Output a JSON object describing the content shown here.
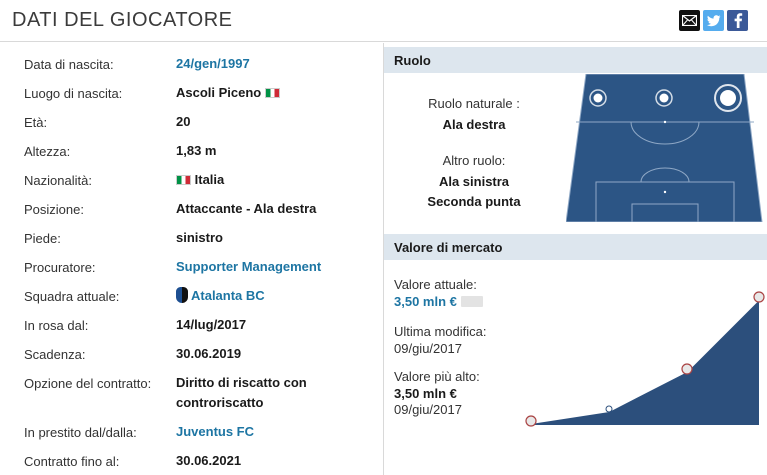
{
  "header": {
    "title": "DATI DEL GIOCATORE"
  },
  "share": {
    "email_icon": "email-icon",
    "twitter_icon": "twitter-icon",
    "facebook_icon": "facebook-icon",
    "twitter_glyph": "t",
    "facebook_glyph": "f"
  },
  "player": {
    "rows": [
      {
        "label": "Data di nascita:",
        "value": "24/gen/1997"
      },
      {
        "label": "Luogo di nascita:",
        "value": "Ascoli Piceno"
      },
      {
        "label": "Età:",
        "value": "20"
      },
      {
        "label": "Altezza:",
        "value": "1,83 m"
      },
      {
        "label": "Nazionalità:",
        "value": "Italia"
      },
      {
        "label": "Posizione:",
        "value": "Attaccante - Ala destra"
      },
      {
        "label": "Piede:",
        "value": "sinistro"
      },
      {
        "label": "Procuratore:",
        "value": "Supporter Management"
      },
      {
        "label": "Squadra attuale:",
        "value": "Atalanta BC"
      },
      {
        "label": "In rosa dal:",
        "value": "14/lug/2017"
      },
      {
        "label": "Scadenza:",
        "value": "30.06.2019"
      },
      {
        "label": "Opzione del contratto:",
        "value": "Diritto di riscatto con",
        "value2": "controriscatto"
      },
      {
        "label": "In prestito dal/dalla:",
        "value": "Juventus FC"
      },
      {
        "label": "Contratto fino al:",
        "value": "30.06.2021"
      }
    ]
  },
  "role": {
    "heading": "Ruolo",
    "natural_label": "Ruolo naturale :",
    "natural_value": "Ala destra",
    "other_label": "Altro ruolo:",
    "other_values": [
      "Ala sinistra",
      "Seconda punta"
    ]
  },
  "market": {
    "heading": "Valore di mercato",
    "current_label": "Valore attuale:",
    "current_value": "3,50 mln €",
    "last_change_label": "Ultima modifica:",
    "last_change_date": "09/giu/2017",
    "highest_label": "Valore più alto:",
    "highest_value": "3,50 mln €",
    "highest_date": "09/giu/2017"
  },
  "colors": {
    "pitch": "#2c5585",
    "accent_link": "#1d75a3",
    "section_header": "#dde6ee",
    "chart_fill": "#2c4f7c"
  }
}
